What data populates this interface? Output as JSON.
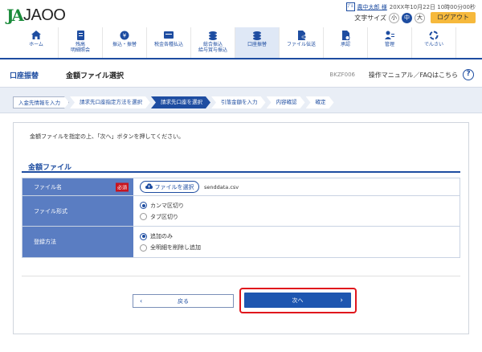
{
  "header": {
    "logo_mark": "JA",
    "logo_text": "JAOO",
    "user_badge": "ﾌﾞﾙ",
    "user_name": "農中太郎 様",
    "last_login": "20XX年10月22日 10時00分00秒",
    "fontsize_label": "文字サイズ",
    "fontsize_small": "小",
    "fontsize_medium": "中",
    "fontsize_large": "大",
    "logout_label": "ログアウト"
  },
  "nav": {
    "items": [
      {
        "label": "ホーム",
        "icon": "home-icon"
      },
      {
        "label": "残高\n明細照会",
        "icon": "ledger-icon"
      },
      {
        "label": "振込・振替",
        "icon": "transfer-icon"
      },
      {
        "label": "税金各種払込",
        "icon": "tax-payment-icon"
      },
      {
        "label": "総合振込\n給与賞与振込",
        "icon": "bulk-transfer-icon"
      },
      {
        "label": "口座振替",
        "icon": "account-transfer-icon"
      },
      {
        "label": "ファイル伝送",
        "icon": "file-transfer-icon"
      },
      {
        "label": "承認",
        "icon": "approval-icon"
      },
      {
        "label": "管理",
        "icon": "admin-icon"
      },
      {
        "label": "でんさい",
        "icon": "densai-icon"
      }
    ]
  },
  "titlebar": {
    "section_name": "口座振替",
    "page_title": "金額ファイル選択",
    "screen_id": "BKZF006",
    "help_text": "操作マニュアル／FAQはこちら",
    "help_icon": "?"
  },
  "steps": {
    "items": [
      {
        "label": "入金先情報を入力"
      },
      {
        "label": "請求先口座指定方法を選択"
      },
      {
        "label": "請求先口座を選択"
      },
      {
        "label": "引落金額を入力"
      },
      {
        "label": "内容確認"
      },
      {
        "label": "確定"
      }
    ]
  },
  "main": {
    "instruction": "金額ファイルを指定の上、「次へ」ボタンを押してください。",
    "box_title": "金額ファイル",
    "file_label": "ファイル名",
    "required_label": "必須",
    "file_button_label": "ファイルを選択",
    "file_name": "senddata.csv",
    "format_label": "ファイル形式",
    "format_options": [
      "カンマ区切り",
      "タブ区切り"
    ],
    "register_label": "登録方法",
    "register_options": [
      "追加のみ",
      "全明細を削除し追加"
    ],
    "back_label": "戻る",
    "next_label": "次へ"
  },
  "colors": {
    "brand_blue": "#1e4da1",
    "label_blue": "#5a7dc2",
    "highlight_red": "#e0161c",
    "logout_orange": "#f6b93c"
  }
}
